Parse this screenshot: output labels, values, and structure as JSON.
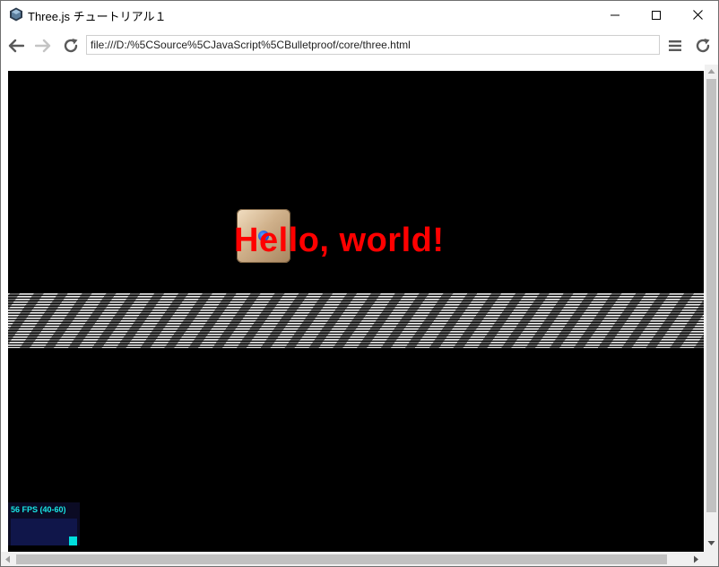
{
  "window": {
    "title": "Three.js チュートリアル１",
    "controls": [
      "minimize-icon",
      "maximize-icon",
      "close-icon"
    ]
  },
  "navbar": {
    "address": "file:///D:/%5CSource%5CJavaScript%5CBulletproof/core/three.html",
    "back_enabled": true,
    "forward_enabled": false
  },
  "scene": {
    "text": "Hello, world!",
    "text_color": "#ff0000",
    "background_color": "#000000"
  },
  "stats": {
    "label": "56 FPS (40-60)",
    "fps": 56,
    "min": 40,
    "max": 60,
    "color": "#19e6e6"
  }
}
